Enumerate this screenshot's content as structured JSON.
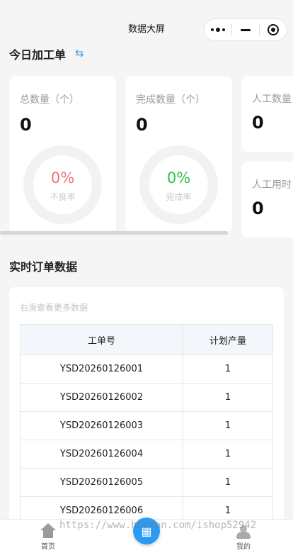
{
  "nav": {
    "title": "数据大屏"
  },
  "today": {
    "title": "今日加工单",
    "swap_icon": "⇆"
  },
  "cards": {
    "total": {
      "label": "总数量（个）",
      "value": "0",
      "ring_pct": "0%",
      "ring_sub": "不良率",
      "ring_color": "#f0757a",
      "percent": 0
    },
    "done": {
      "label": "完成数量（个）",
      "value": "0",
      "ring_pct": "0%",
      "ring_sub": "完成率",
      "ring_color": "#2ec24b",
      "percent": 0
    },
    "manual_qty": {
      "label": "人工数量",
      "value": "0"
    },
    "manual_time": {
      "label": "人工用时",
      "value": "0"
    }
  },
  "orders": {
    "title": "实时订单数据",
    "hint": "右滑查看更多数据",
    "headers": [
      "工单号",
      "计划产量"
    ],
    "rows": [
      [
        "YSD20260126001",
        "1"
      ],
      [
        "YSD20260126002",
        "1"
      ],
      [
        "YSD20260126003",
        "1"
      ],
      [
        "YSD20260126004",
        "1"
      ],
      [
        "YSD20260126005",
        "1"
      ],
      [
        "YSD20260126006",
        "1"
      ]
    ]
  },
  "tabbar": {
    "home": "首页",
    "center_icon": "▦",
    "mine": "我的"
  },
  "watermark": "https://www.huzhan.com/ishop52942"
}
